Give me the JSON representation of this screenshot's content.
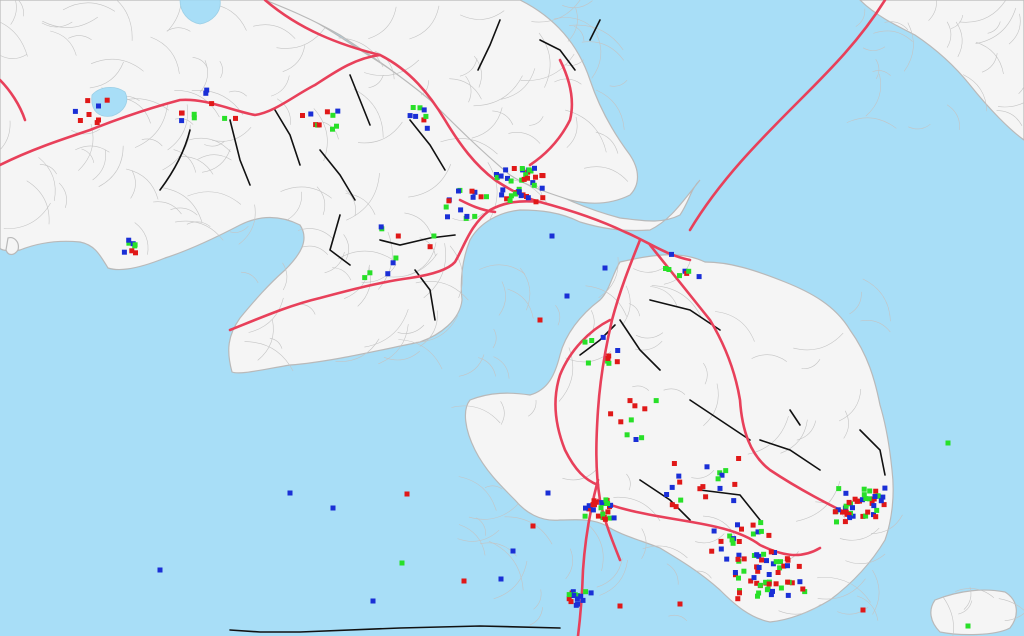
{
  "map": {
    "colors": {
      "water": "#a8def7",
      "land": "#f5f5f5",
      "land_outline": "#b9b9b9",
      "contour": "#c4c4c4",
      "road_main": "#e8405a",
      "road_minor": "#111111",
      "marker_red": "#e01818",
      "marker_blue": "#1a2fd6",
      "marker_green": "#28e028"
    },
    "legend": [],
    "labels": []
  }
}
